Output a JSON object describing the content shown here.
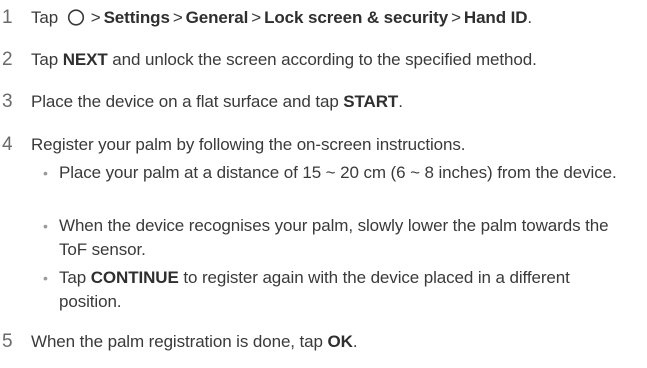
{
  "steps": [
    {
      "number": "1",
      "tap": "Tap",
      "home_icon": "home-circle-icon",
      "sep": ">",
      "path": [
        "Settings",
        "General",
        "Lock screen & security",
        "Hand ID"
      ],
      "end": "."
    },
    {
      "number": "2",
      "pre": "Tap ",
      "bold": "NEXT",
      "post": " and unlock the screen according to the specified method."
    },
    {
      "number": "3",
      "pre": "Place the device on a flat surface and tap ",
      "bold": "START",
      "post": "."
    },
    {
      "number": "4",
      "text": "Register your palm by following the on-screen instructions.",
      "bullets": [
        {
          "text": "Place your palm at a distance of 15 ~ 20 cm (6 ~ 8 inches) from the device."
        },
        {
          "text": "When the device recognises your palm, slowly lower the palm towards the ToF sensor."
        },
        {
          "pre": "Tap ",
          "bold": "CONTINUE",
          "post": " to register again with the device placed in a different position."
        }
      ]
    },
    {
      "number": "5",
      "pre": "When the palm registration is done, tap ",
      "bold": "OK",
      "post": "."
    }
  ],
  "bullet_glyph": "•"
}
